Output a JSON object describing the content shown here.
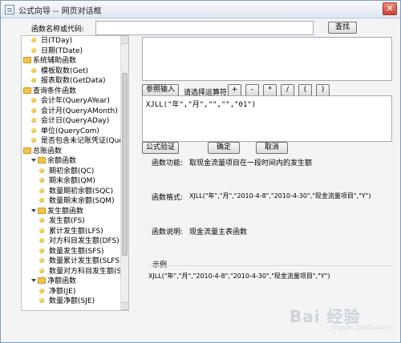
{
  "window": {
    "title": "公式向导 -- 网页对话框",
    "close_glyph": "✕"
  },
  "search": {
    "label": "函数名称或代码:",
    "value": "",
    "button": "查找"
  },
  "tree": {
    "items": [
      {
        "kind": "leaf",
        "label": "日(TDay)",
        "indent": 1
      },
      {
        "kind": "leaf",
        "label": "日期(TDate)",
        "indent": 1
      },
      {
        "kind": "folder",
        "label": "系统辅助函数",
        "indent": 0
      },
      {
        "kind": "leaf",
        "label": "模板取数(Get)",
        "indent": 1
      },
      {
        "kind": "leaf",
        "label": "报表取数(GetData)",
        "indent": 1
      },
      {
        "kind": "folder",
        "label": "查询条件函数",
        "indent": 0
      },
      {
        "kind": "leaf",
        "label": "会计年(QueryAYear)",
        "indent": 1
      },
      {
        "kind": "leaf",
        "label": "会计月(QueryAMonth)",
        "indent": 1
      },
      {
        "kind": "leaf",
        "label": "会计日(QueryADay)",
        "indent": 1
      },
      {
        "kind": "leaf",
        "label": "单位(QueryCom)",
        "indent": 1
      },
      {
        "kind": "leaf",
        "label": "是否包含未记账凭证(QueryP",
        "indent": 1
      },
      {
        "kind": "folder",
        "label": "总账函数",
        "indent": 0
      },
      {
        "kind": "expanded-folder",
        "label": "余额函数",
        "indent": 1
      },
      {
        "kind": "leaf",
        "label": "期初余额(QC)",
        "indent": 2
      },
      {
        "kind": "leaf",
        "label": "期末余额(QM)",
        "indent": 2
      },
      {
        "kind": "leaf",
        "label": "数量期初余额(SQC)",
        "indent": 2
      },
      {
        "kind": "leaf",
        "label": "数量期末余额(SQM)",
        "indent": 2
      },
      {
        "kind": "expanded-folder",
        "label": "发生额函数",
        "indent": 1
      },
      {
        "kind": "leaf",
        "label": "发生额(FS)",
        "indent": 2
      },
      {
        "kind": "leaf",
        "label": "累计发生额(LFS)",
        "indent": 2
      },
      {
        "kind": "leaf",
        "label": "对方科目发生额(DFS)",
        "indent": 2
      },
      {
        "kind": "leaf",
        "label": "数量发生额(SFS)",
        "indent": 2
      },
      {
        "kind": "leaf",
        "label": "数量累计发生额(SLFS)",
        "indent": 2
      },
      {
        "kind": "leaf",
        "label": "数量对方科目发生额(SDI",
        "indent": 2
      },
      {
        "kind": "expanded-folder",
        "label": "净额函数",
        "indent": 1
      },
      {
        "kind": "leaf",
        "label": "净额(JE)",
        "indent": 2
      },
      {
        "kind": "leaf",
        "label": "数量净额(SJE)",
        "indent": 2
      }
    ]
  },
  "toolbar": {
    "ref_input": "参照输入",
    "operator_label": "请选择运算符:",
    "operators": [
      "+",
      "-",
      "*",
      "/",
      "(",
      ")"
    ]
  },
  "formula": {
    "value": "XJLL(\"年\",\"月\",\"\",\"\",\"01\")"
  },
  "actions": {
    "verify": "公式验证",
    "ok": "确定",
    "cancel": "取消"
  },
  "info": {
    "func_label": "函数功能:",
    "func_value": "取现金流量项目在一段时间内的发生额",
    "format_label": "函数格式:",
    "format_value": "XJLL(\"年\",\"月\",\"2010-4-8\",\"2010-4-30\",\"现金流量项目\",\"Y\")",
    "desc_label": "函数说明:",
    "desc_value": "现金流量主表函数",
    "example_label": "示例",
    "example_value": "XJLL(\"年\",\"月\",\"2010-4-8\",\"2010-4-30\",\"现金流量项目\",\"Y\")"
  },
  "watermark": {
    "text": "Bai 经验",
    "sub": "jingyan.baidu.com"
  }
}
